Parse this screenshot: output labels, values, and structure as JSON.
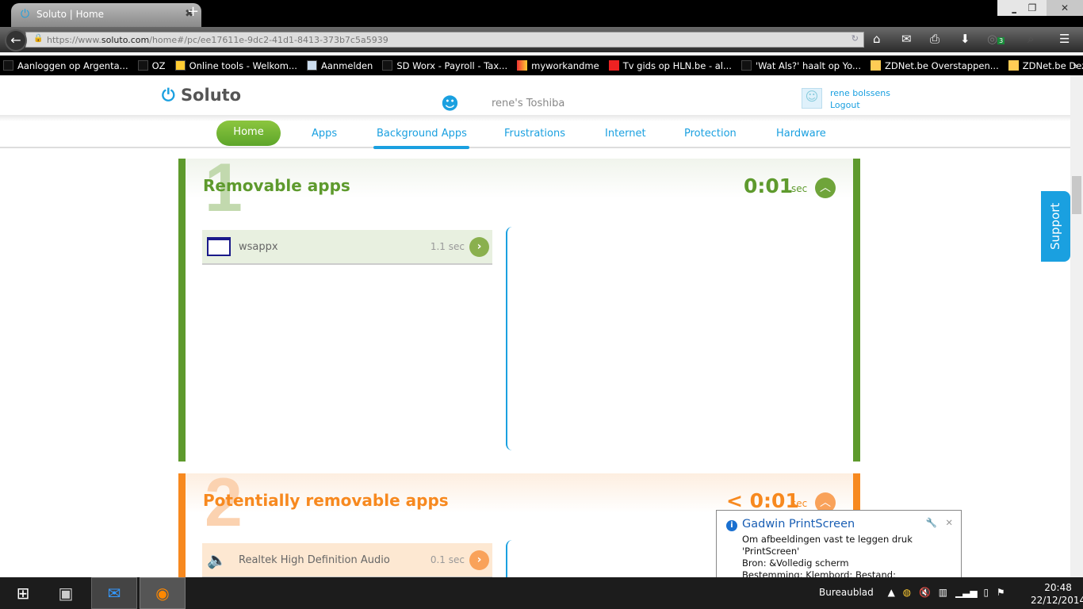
{
  "browser": {
    "tab_title": "Soluto | Home",
    "url_prefix": "https://www.",
    "url_domain": "soluto.com",
    "url_path": "/home#/pc/ee17611e-9dc2-41d1-8413-373b7c5a5939",
    "addon_badge": "3",
    "bookmarks": [
      "Aanloggen op Argenta...",
      "OZ",
      "Online tools - Welkom...",
      "Aanmelden",
      "SD Worx - Payroll - Tax...",
      "myworkandme",
      "Tv gids op HLN.be - al...",
      "'Wat Als?' haalt op Yo...",
      "ZDNet.be Overstappen...",
      "ZDNet.be Deze week: i..."
    ]
  },
  "site": {
    "logo": "Soluto",
    "pc_name": "rene's Toshiba",
    "user_name": "rene bolssens",
    "logout": "Logout",
    "nav": [
      "Home",
      "Apps",
      "Background Apps",
      "Frustrations",
      "Internet",
      "Protection",
      "Hardware"
    ],
    "active_nav": "Background Apps",
    "support": "Support"
  },
  "sections": [
    {
      "number": "1",
      "title": "Removable apps",
      "time": "0:01",
      "unit": "sec",
      "color": "#5e9a2d",
      "apps": [
        {
          "name": "wsappx",
          "time": "1.1 sec"
        }
      ]
    },
    {
      "number": "2",
      "title": "Potentially removable apps",
      "time": "< 0:01",
      "unit": "sec",
      "color": "#f7891f",
      "apps": [
        {
          "name": "Realtek High Definition Audio",
          "time": "0.1 sec"
        }
      ]
    }
  ],
  "notification": {
    "title": "Gadwin PrintScreen",
    "lines": [
      "Om afbeeldingen vast te leggen druk 'PrintScreen'",
      "Bron:  &Volledig scherm",
      "Bestemming:  Klembord; Bestand;"
    ]
  },
  "taskbar": {
    "desktop_label": "Bureaublad",
    "time": "20:48",
    "date": "22/12/2014"
  }
}
